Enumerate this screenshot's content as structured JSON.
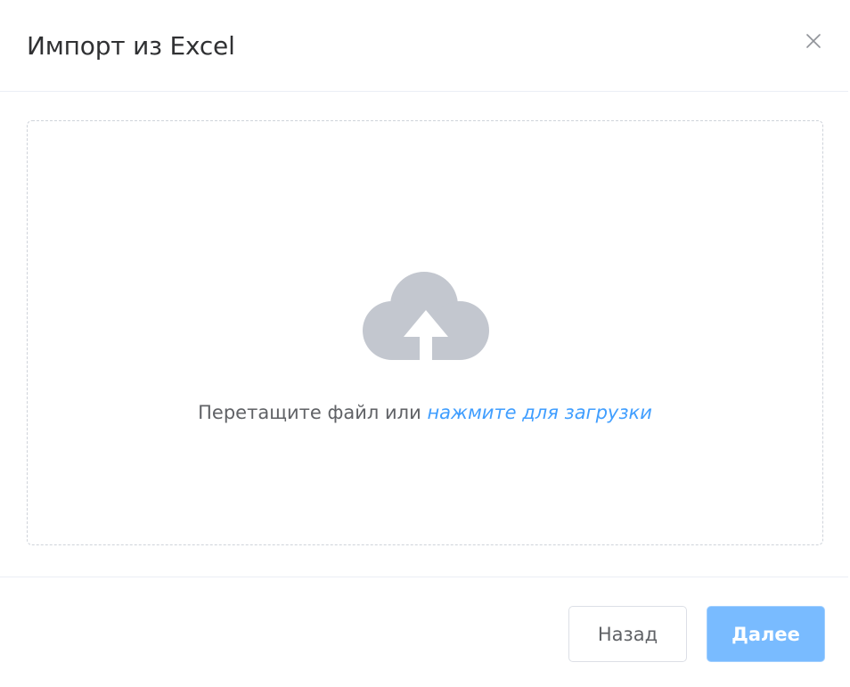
{
  "dialog": {
    "title": "Импорт из Excel",
    "close_icon": "close-icon"
  },
  "dropzone": {
    "icon": "cloud-upload-icon",
    "text": "Перетащите файл или",
    "link_text": "нажмите для загрузки"
  },
  "footer": {
    "back_label": "Назад",
    "next_label": "Далее"
  },
  "colors": {
    "accent": "#409eff",
    "primary_button_disabled": "#79bbff",
    "icon_gray": "#c3c7cf",
    "title_text": "#303133",
    "body_text": "#606266"
  }
}
